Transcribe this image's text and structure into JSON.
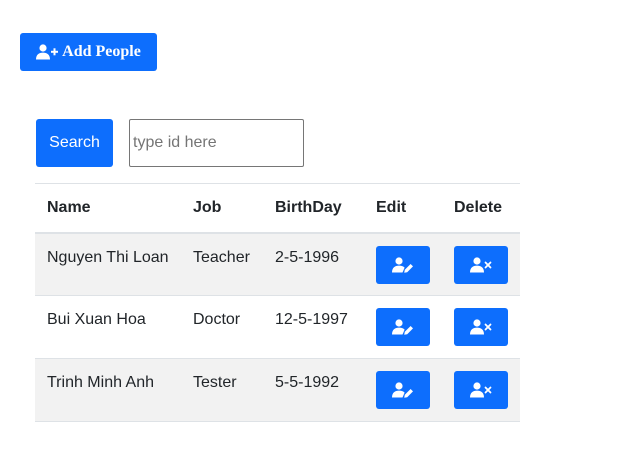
{
  "toolbar": {
    "add_label": "Add People",
    "add_icon": "user-plus-icon"
  },
  "search": {
    "button_label": "Search",
    "placeholder": "type id here",
    "value": ""
  },
  "table": {
    "headers": {
      "name": "Name",
      "job": "Job",
      "birthday": "BirthDay",
      "edit": "Edit",
      "delete": "Delete"
    },
    "rows": [
      {
        "name": "Nguyen Thi Loan",
        "job": "Teacher",
        "birthday": "2-5-1996"
      },
      {
        "name": "Bui Xuan Hoa",
        "job": "Doctor",
        "birthday": "12-5-1997"
      },
      {
        "name": "Trinh Minh Anh",
        "job": "Tester",
        "birthday": "5-5-1992"
      }
    ],
    "edit_icon": "user-edit-icon",
    "delete_icon": "user-remove-icon"
  },
  "colors": {
    "primary": "#0d6efd",
    "stripe": "#f2f2f2",
    "border": "#dee2e6"
  }
}
